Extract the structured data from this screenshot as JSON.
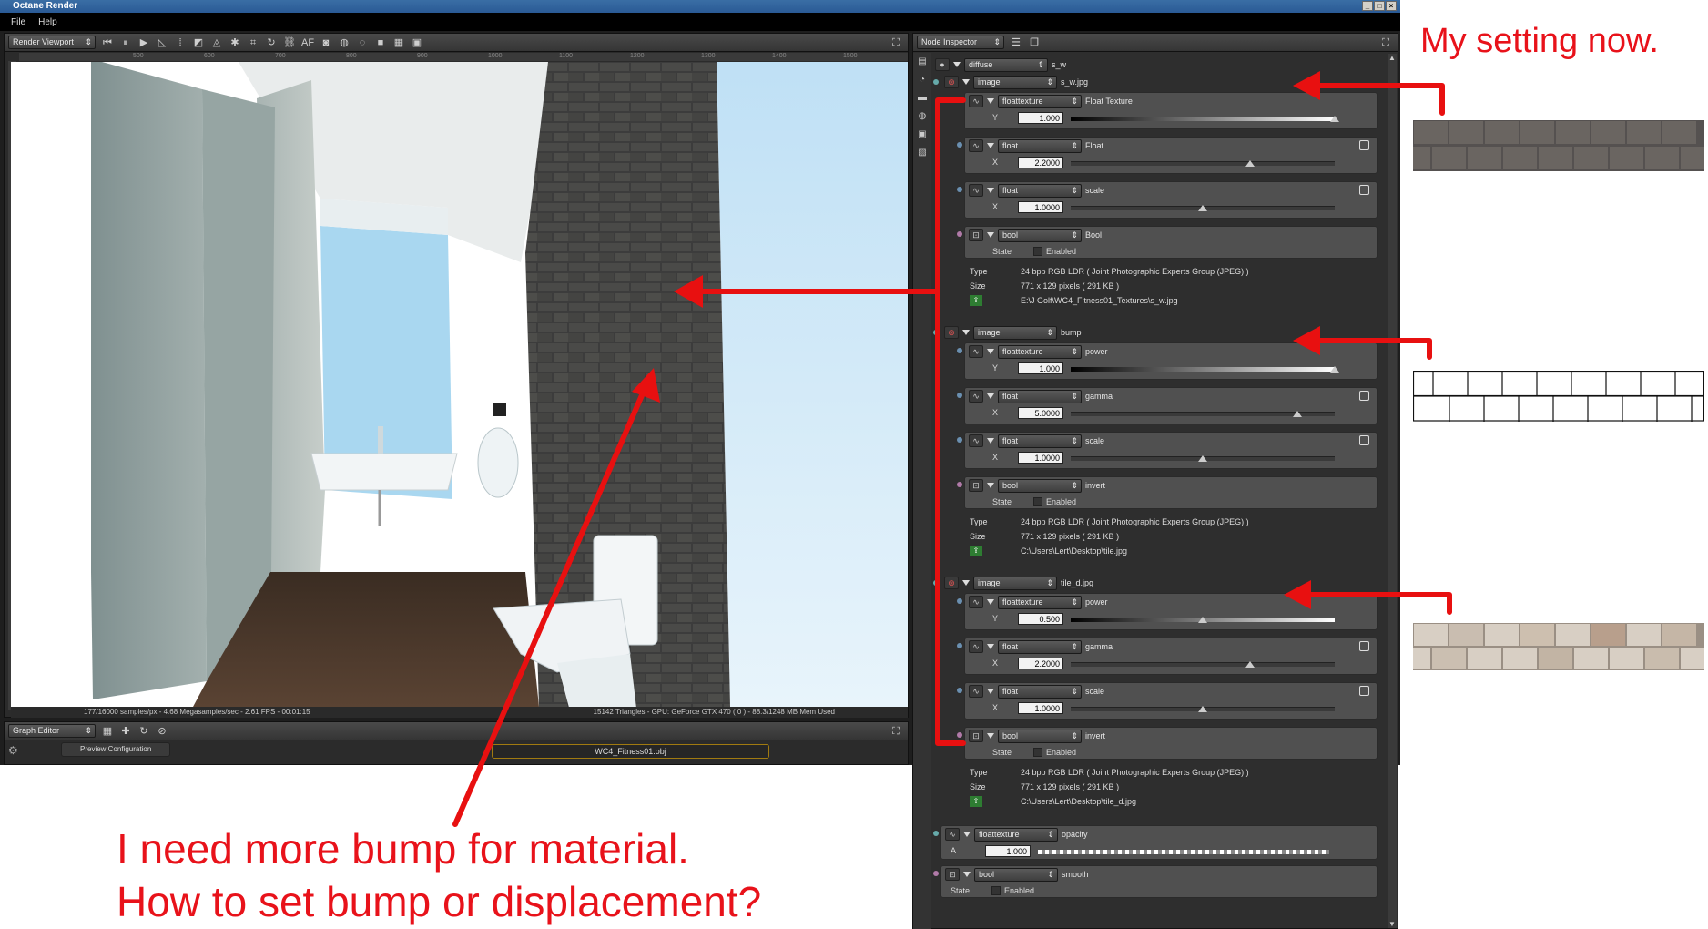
{
  "window": {
    "title": "Octane Render",
    "controls": [
      "_",
      "□",
      "×"
    ]
  },
  "menu": [
    "File",
    "Help"
  ],
  "render_viewport": {
    "combo": "Render Viewport",
    "ruler_ticks": [
      "500",
      "600",
      "700",
      "800",
      "900",
      "1000",
      "1100",
      "1200",
      "1300",
      "1400",
      "1500"
    ],
    "toolbar_af": "AF",
    "status_left": "177/16000 samples/px - 4.68 Megasamples/sec - 2.61 FPS - 00:01:15",
    "status_right": "15142 Triangles - GPU: GeForce GTX 470 ( 0 ) - 88.3/1248 MB Mem Used"
  },
  "graph_editor": {
    "combo": "Graph Editor",
    "preview_label": "Preview Configuration",
    "node_label": "WC4_Fitness01.obj"
  },
  "inspector": {
    "title_combo": "Node Inspector",
    "root": {
      "type": "diffuse",
      "name": "s_w"
    },
    "images": [
      {
        "type": "image",
        "name": "s_w.jpg",
        "rows": [
          {
            "type": "floattexture",
            "name": "Float Texture",
            "axis": "Y",
            "value": "1.000",
            "pos": 1.0,
            "track": "gradient"
          },
          {
            "type": "float",
            "name": "Float",
            "axis": "X",
            "value": "2.2000",
            "pos": 0.68,
            "track": "plain"
          },
          {
            "type": "float",
            "name": "scale",
            "axis": "X",
            "value": "1.0000",
            "pos": 0.5,
            "track": "plain"
          }
        ],
        "bool": {
          "type": "bool",
          "name": "Bool",
          "state_label": "State",
          "enabled_label": "Enabled"
        },
        "info": {
          "type_label": "Type",
          "type_value": "24 bpp RGB LDR ( Joint Photographic Experts Group (JPEG) )",
          "size_label": "Size",
          "size_value": "771 x 129 pixels ( 291 KB )",
          "path": "E:\\J Golf\\WC4_Fitness01_Textures\\s_w.jpg"
        }
      },
      {
        "type": "image",
        "name": "bump",
        "rows": [
          {
            "type": "floattexture",
            "name": "power",
            "axis": "Y",
            "value": "1.000",
            "pos": 1.0,
            "track": "gradient"
          },
          {
            "type": "float",
            "name": "gamma",
            "axis": "X",
            "value": "5.0000",
            "pos": 0.86,
            "track": "plain"
          },
          {
            "type": "float",
            "name": "scale",
            "axis": "X",
            "value": "1.0000",
            "pos": 0.5,
            "track": "plain"
          }
        ],
        "bool": {
          "type": "bool",
          "name": "invert",
          "state_label": "State",
          "enabled_label": "Enabled"
        },
        "info": {
          "type_label": "Type",
          "type_value": "24 bpp RGB LDR ( Joint Photographic Experts Group (JPEG) )",
          "size_label": "Size",
          "size_value": "771 x 129 pixels ( 291 KB )",
          "path": "C:\\Users\\Lert\\Desktop\\tile.jpg"
        }
      },
      {
        "type": "image",
        "name": "tile_d.jpg",
        "rows": [
          {
            "type": "floattexture",
            "name": "power",
            "axis": "Y",
            "value": "0.500",
            "pos": 0.5,
            "track": "gradient"
          },
          {
            "type": "float",
            "name": "gamma",
            "axis": "X",
            "value": "2.2000",
            "pos": 0.68,
            "track": "plain"
          },
          {
            "type": "float",
            "name": "scale",
            "axis": "X",
            "value": "1.0000",
            "pos": 0.5,
            "track": "plain"
          }
        ],
        "bool": {
          "type": "bool",
          "name": "invert",
          "state_label": "State",
          "enabled_label": "Enabled"
        },
        "info": {
          "type_label": "Type",
          "type_value": "24 bpp RGB LDR ( Joint Photographic Experts Group (JPEG) )",
          "size_label": "Size",
          "size_value": "771 x 129 pixels ( 291 KB )",
          "path": "C:\\Users\\Lert\\Desktop\\tile_d.jpg"
        }
      }
    ],
    "opacity": {
      "type": "floattexture",
      "name": "opacity",
      "axis": "A",
      "value": "1.000"
    },
    "smooth": {
      "type": "bool",
      "name": "smooth",
      "state_label": "State",
      "enabled_label": "Enabled"
    }
  },
  "annotations": {
    "my_setting": "My setting now.",
    "question_line1": "I need more bump for material.",
    "question_line2": "How to set bump or displacement?"
  },
  "colors": {
    "annotation_red": "#e81010",
    "panel_dark": "#2b2b2b",
    "node_grey": "#505050"
  }
}
